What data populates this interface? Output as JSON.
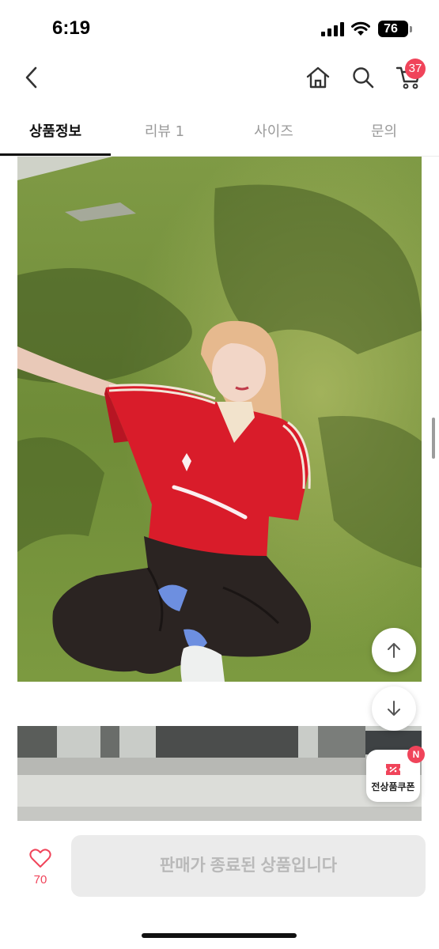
{
  "status_bar": {
    "time": "6:19",
    "battery": "76"
  },
  "header": {
    "back_icon": "chevron-left-icon",
    "home_icon": "home-icon",
    "search_icon": "search-icon",
    "cart_icon": "cart-icon",
    "cart_count": "37"
  },
  "tabs": [
    {
      "label": "상품정보",
      "active": true
    },
    {
      "label": "리뷰 1",
      "active": false
    },
    {
      "label": "사이즈",
      "active": false
    },
    {
      "label": "문의",
      "active": false
    }
  ],
  "floating": {
    "scroll_up_icon": "arrow-up-icon",
    "scroll_down_icon": "arrow-down-icon",
    "coupon_label": "전상품쿠폰",
    "coupon_badge": "N"
  },
  "bottom_bar": {
    "like_count": "70",
    "status_button": "판매가 종료된 상품입니다"
  },
  "colors": {
    "accent": "#f0445a",
    "disabled_bg": "#ebebeb",
    "disabled_text": "#b9b9b9"
  }
}
